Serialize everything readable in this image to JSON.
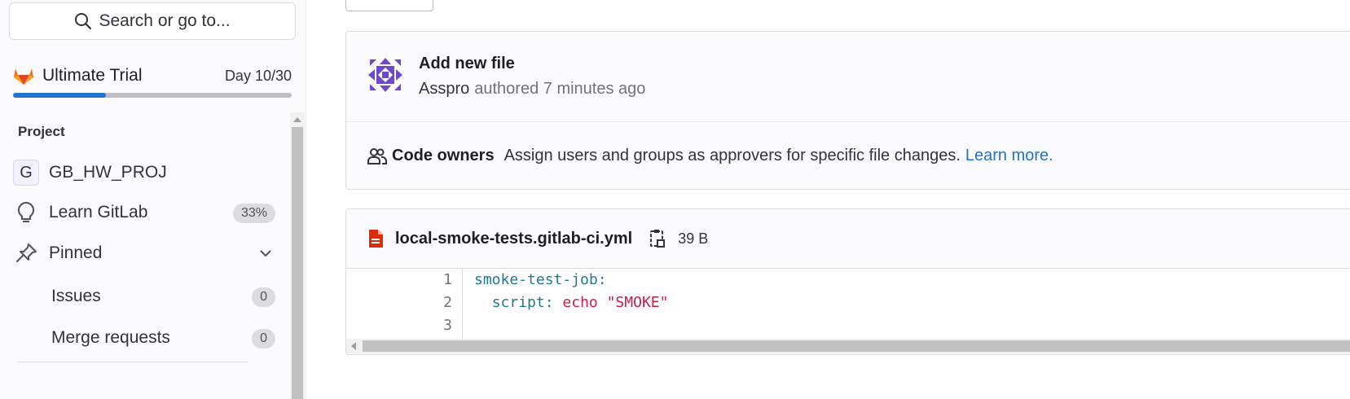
{
  "sidebar": {
    "search_label": "Search or go to...",
    "trial": {
      "title": "Ultimate Trial",
      "day": "Day 10/30",
      "progress": 0.333
    },
    "section_title": "Project",
    "project": {
      "initial": "G",
      "name": "GB_HW_PROJ"
    },
    "learn": {
      "label": "Learn GitLab",
      "badge": "33%"
    },
    "pinned": {
      "label": "Pinned"
    },
    "issues": {
      "label": "Issues",
      "count": "0"
    },
    "merge_requests": {
      "label": "Merge requests",
      "count": "0"
    }
  },
  "commit": {
    "title": "Add new file",
    "author": "Asspro",
    "meta": "authored 7 minutes ago"
  },
  "code_owners": {
    "title": "Code owners",
    "description": "Assign users and groups as approvers for specific file changes.",
    "link": "Learn more."
  },
  "file": {
    "name": "local-smoke-tests.gitlab-ci.yml",
    "size": "39 B",
    "line_numbers": [
      "1",
      "2",
      "3"
    ],
    "lines": {
      "l1_key": "smoke-test-job:",
      "l2_indent": "  ",
      "l2_key": "script:",
      "l2_cmd": "echo",
      "l2_str": "\"SMOKE\""
    }
  },
  "colors": {
    "accent": "#1f75cb",
    "file_icon": "#dd2b0e",
    "avatar": "#6e49cb",
    "gitlab_orange": "#e24329"
  }
}
